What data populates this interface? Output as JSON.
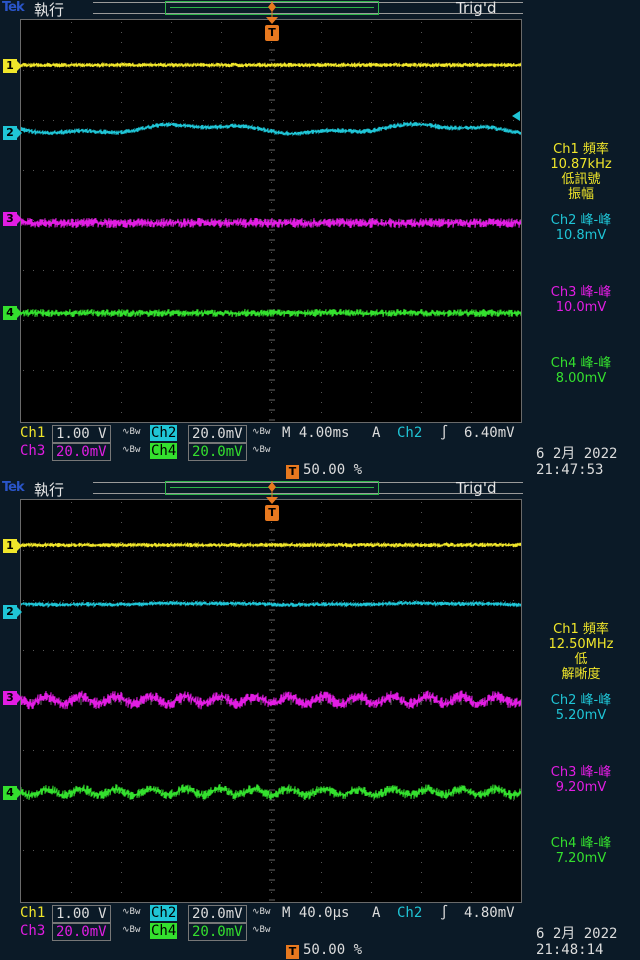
{
  "colors": {
    "ch1": "#f0e62a",
    "ch2": "#1fc5d6",
    "ch3": "#e21de3",
    "ch4": "#34e02e",
    "trigger": "#e8791f",
    "background": "#0b1a27"
  },
  "scopes": [
    {
      "logo": "Tek",
      "run_state": "執行",
      "trigger_status": "Trig'd",
      "trigger_marker": "T",
      "channel_markers": [
        "1",
        "2",
        "3",
        "4"
      ],
      "measurements": {
        "ch1_label": "Ch1 頻率",
        "ch1_value": "10.87kHz",
        "ch1_note1": "低訊號",
        "ch1_note2": "振幅",
        "ch2_label": "Ch2 峰-峰",
        "ch2_value": "10.8mV",
        "ch3_label": "Ch3 峰-峰",
        "ch3_value": "10.0mV",
        "ch4_label": "Ch4 峰-峰",
        "ch4_value": "8.00mV"
      },
      "status": {
        "ch1_name": "Ch1",
        "ch1_scale": "1.00 V",
        "ch2_name": "Ch2",
        "ch2_scale": "20.0mV",
        "timebase": "M 4.00ms",
        "trig_mode": "A",
        "trig_source": "Ch2",
        "trig_slope": "∫",
        "trig_level": "6.40mV",
        "ch3_name": "Ch3",
        "ch3_scale": "20.0mV",
        "ch4_name": "Ch4",
        "ch4_scale": "20.0mV",
        "bw_icon": "∿Bw",
        "trig_position": "50.00 %"
      },
      "date": "6 2月  2022",
      "time": "21:47:53"
    },
    {
      "logo": "Tek",
      "run_state": "執行",
      "trigger_status": "Trig'd",
      "trigger_marker": "T",
      "channel_markers": [
        "1",
        "2",
        "3",
        "4"
      ],
      "measurements": {
        "ch1_label": "Ch1 頻率",
        "ch1_value": "12.50MHz",
        "ch1_note1": "低",
        "ch1_note2": "解晰度",
        "ch2_label": "Ch2 峰-峰",
        "ch2_value": "5.20mV",
        "ch3_label": "Ch3 峰-峰",
        "ch3_value": "9.20mV",
        "ch4_label": "Ch4 峰-峰",
        "ch4_value": "7.20mV"
      },
      "status": {
        "ch1_name": "Ch1",
        "ch1_scale": "1.00 V",
        "ch2_name": "Ch2",
        "ch2_scale": "20.0mV",
        "timebase": "M 40.0µs",
        "trig_mode": "A",
        "trig_source": "Ch2",
        "trig_slope": "∫",
        "trig_level": "4.80mV",
        "ch3_name": "Ch3",
        "ch3_scale": "20.0mV",
        "ch4_name": "Ch4",
        "ch4_scale": "20.0mV",
        "bw_icon": "∿Bw",
        "trig_position": "50.00 %"
      },
      "date": "6 2月  2022",
      "time": "21:48:14"
    }
  ]
}
